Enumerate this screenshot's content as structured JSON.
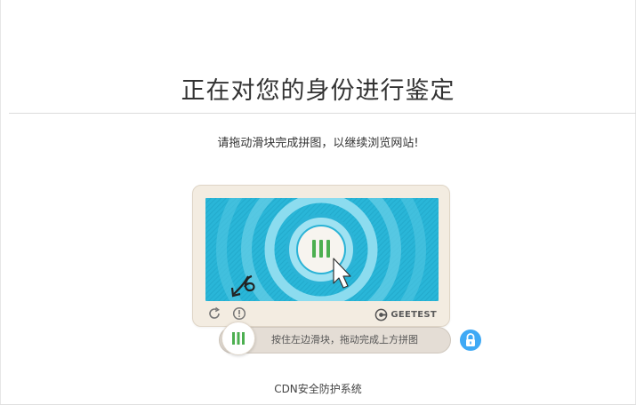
{
  "page": {
    "title": "正在对您的身份进行鉴定",
    "instruction": "请拖动滑块完成拼图，以继续浏览网站!",
    "footer": "CDN安全防护系统"
  },
  "captcha": {
    "brand": "GEETEST",
    "slider_hint": "按住左边滑块，拖动完成上方拼图",
    "colors": {
      "image_bg": "#29b6d8",
      "ring": "#7fd6ec",
      "handle_bars": "#4caf50",
      "panel_bg": "#f3ece1",
      "lock_bg": "#3fa9f5"
    },
    "icons": [
      "refresh-icon",
      "feedback-icon",
      "geetest-logo-icon",
      "lock-icon",
      "cursor-arrow-icon",
      "hint-arrow-icon"
    ]
  }
}
